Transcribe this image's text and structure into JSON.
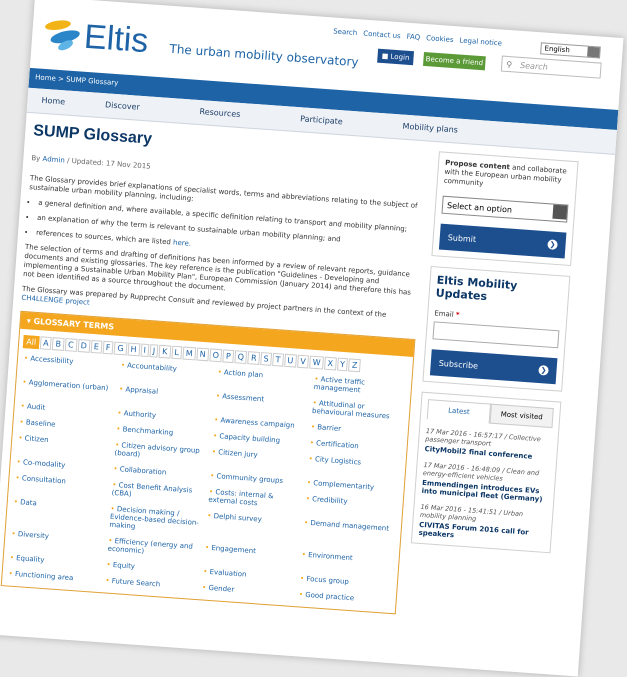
{
  "header": {
    "logo": "Eltis",
    "tagline": "The urban mobility observatory",
    "toplinks": [
      "Search",
      "Contact us",
      "FAQ",
      "Cookies",
      "Legal notice"
    ],
    "language": "English",
    "login": "Login",
    "friend": "Become a friend",
    "search_placeholder": "Search"
  },
  "breadcrumb": "Home > SUMP Glossary",
  "nav": [
    "Home",
    "Discover",
    "Resources",
    "Participate",
    "Mobility plans"
  ],
  "main": {
    "title": "SUMP Glossary",
    "by_prefix": "By",
    "author": "Admin",
    "updated": "/ Updated: 17 Nov 2015",
    "intro": "The Glossary provides brief explanations of specialist words, terms and abbreviations relating to the subject of sustainable urban mobility planning, including:",
    "bullets": [
      "a general definition and, where available, a specific definition relating to transport and mobility planning;",
      "an explanation of why the term is relevant to sustainable urban mobility planning; and",
      "references to sources, which are listed"
    ],
    "here": "here.",
    "para2": "The selection of terms and drafting of definitions has been informed by a review of relevant reports, guidance documents and existing glossaries. The key reference is the publication \"Guidelines - Developing and implementing a Sustainable Urban Mobility Plan\", European Commission (January 2014) and therefore this has not been identified as a source throughout the document.",
    "para3": "The Glossary was prepared by Rupprecht Consult and reviewed by project partners in the context of the",
    "challenge": "CH4LLENGE project"
  },
  "glossary": {
    "heading": "GLOSSARY TERMS",
    "letters": [
      "All",
      "A",
      "B",
      "C",
      "D",
      "E",
      "F",
      "G",
      "H",
      "I",
      "J",
      "K",
      "L",
      "M",
      "N",
      "O",
      "P",
      "Q",
      "R",
      "S",
      "T",
      "U",
      "V",
      "W",
      "X",
      "Y",
      "Z"
    ],
    "terms": [
      "Accessibility",
      "Accountability",
      "Action plan",
      "Active traffic management",
      "Agglomeration (urban)",
      "Appraisal",
      "Assessment",
      "Attitudinal or behavioural measures",
      "Audit",
      "Authority",
      "Awareness campaign",
      "Barrier",
      "Baseline",
      "Benchmarking",
      "Capacity building",
      "Certification",
      "Citizen",
      "Citizen advisory group (board)",
      "Citizen jury",
      "City Logistics",
      "Co-modality",
      "Collaboration",
      "Community groups",
      "Complementarity",
      "Consultation",
      "Cost Benefit Analysis (CBA)",
      "Costs: internal & external costs",
      "Credibility",
      "Data",
      "Decision making / Evidence-based decision-making",
      "Delphi survey",
      "Demand management",
      "Diversity",
      "Efficiency (energy and economic)",
      "Engagement",
      "Environment",
      "Equality",
      "Equity",
      "Evaluation",
      "Focus group",
      "Functioning area",
      "Future Search",
      "Gender",
      "Good practice"
    ]
  },
  "sidebar": {
    "propose_bold": "Propose content",
    "propose_rest": "and collaborate with the European urban mobility community",
    "select": "Select an option",
    "submit": "Submit",
    "updates_title": "Eltis Mobility Updates",
    "email_label": "Email",
    "subscribe": "Subscribe",
    "tab_latest": "Latest",
    "tab_most": "Most visited",
    "news": [
      {
        "meta": "17 Mar 2016 - 16:57:17 / Collective passenger transport",
        "title": "CityMobil2 final conference"
      },
      {
        "meta": "17 Mar 2016 - 16:48:09 / Clean and energy-efficient vehicles",
        "title": "Emmendingen introduces EVs into municipal fleet (Germany)"
      },
      {
        "meta": "16 Mar 2016 - 15:41:51 / Urban mobility planning",
        "title": "CIVITAS Forum 2016 call for speakers"
      }
    ]
  }
}
